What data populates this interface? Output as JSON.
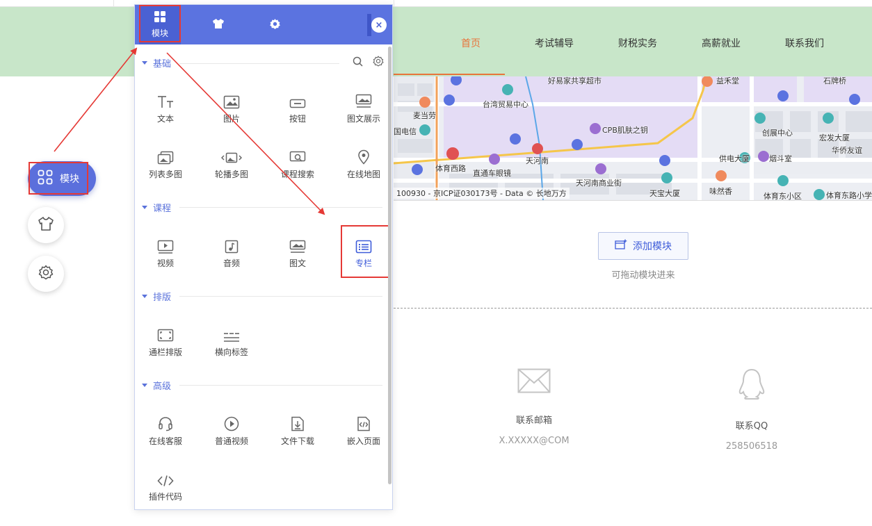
{
  "nav": {
    "items": [
      {
        "label": "首页",
        "active": true
      },
      {
        "label": "考试辅导",
        "active": false
      },
      {
        "label": "财税实务",
        "active": false
      },
      {
        "label": "高薪就业",
        "active": false
      },
      {
        "label": "联系我们",
        "active": false
      }
    ]
  },
  "map": {
    "labels": [
      "好易家共享超市",
      "益禾堂",
      "石牌桥",
      "麦当劳",
      "台湾贸易中心",
      "国电信",
      "CPB肌肤之钥",
      "创展中心",
      "宏发大厦",
      "华侨友谊",
      "体育西路",
      "直通车眼镜",
      "天河南",
      "供电大厦",
      "烟斗室",
      "天河南商业街",
      "味然香",
      "天宝大厦",
      "体育东小区",
      "体育东路小学"
    ],
    "copyright": "100930 - 京ICP证030173号 - Data © 长地万方"
  },
  "add_module": {
    "button_label": "添加模块",
    "hint": "可拖动模块进来"
  },
  "contact": {
    "email_label": "联系邮箱",
    "email_value": "X.XXXXX@COM",
    "qq_label": "联系QQ",
    "qq_value": "258506518"
  },
  "floating": {
    "module_label": "模块"
  },
  "panel": {
    "tabs": [
      {
        "label": "模块",
        "icon": "grid-icon",
        "active": true
      },
      {
        "label": "",
        "icon": "shirt-icon",
        "active": false
      },
      {
        "label": "",
        "icon": "gear-icon",
        "active": false
      }
    ],
    "close_label": "×",
    "sections": [
      {
        "title": "基础",
        "items": [
          {
            "label": "文本",
            "icon": "text-icon"
          },
          {
            "label": "图片",
            "icon": "image-icon"
          },
          {
            "label": "按钮",
            "icon": "button-icon"
          },
          {
            "label": "图文展示",
            "icon": "image-text-icon"
          },
          {
            "label": "列表多图",
            "icon": "list-images-icon"
          },
          {
            "label": "轮播多图",
            "icon": "carousel-icon"
          },
          {
            "label": "课程搜索",
            "icon": "course-search-icon"
          },
          {
            "label": "在线地图",
            "icon": "map-pin-icon"
          }
        ]
      },
      {
        "title": "课程",
        "items": [
          {
            "label": "视频",
            "icon": "video-icon"
          },
          {
            "label": "音频",
            "icon": "audio-icon"
          },
          {
            "label": "图文",
            "icon": "article-icon"
          },
          {
            "label": "专栏",
            "icon": "column-icon",
            "selected": true
          }
        ]
      },
      {
        "title": "排版",
        "items": [
          {
            "label": "通栏排版",
            "icon": "fullwidth-icon"
          },
          {
            "label": "横向标签",
            "icon": "tabs-icon"
          }
        ]
      },
      {
        "title": "高级",
        "items": [
          {
            "label": "在线客服",
            "icon": "headset-icon"
          },
          {
            "label": "普通视频",
            "icon": "play-circle-icon"
          },
          {
            "label": "文件下载",
            "icon": "download-icon"
          },
          {
            "label": "嵌入页面",
            "icon": "embed-icon"
          },
          {
            "label": "插件代码",
            "icon": "code-icon"
          }
        ]
      }
    ]
  },
  "colors": {
    "accent": "#5b73e0",
    "nav_band": "#c8e6c9",
    "nav_active": "#e8743b",
    "highlight": "#e53935"
  }
}
